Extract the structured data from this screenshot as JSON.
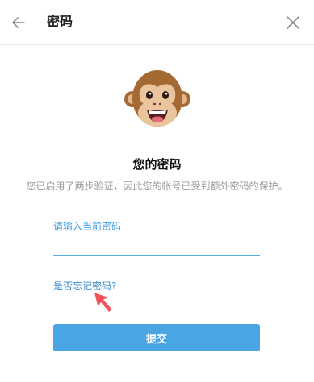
{
  "header": {
    "title": "密码",
    "back_icon": "arrow-left-icon",
    "close_icon": "close-icon"
  },
  "avatar": {
    "icon": "monkey-face-icon"
  },
  "section": {
    "title": "您的密码",
    "description": "您已启用了两步验证，因此您的帐号已受到额外密码的保护。"
  },
  "password_field": {
    "label": "请输入当前密码",
    "value": "",
    "placeholder": ""
  },
  "forgot_link": "是否忘记密码?",
  "submit_label": "提交",
  "colors": {
    "accent": "#4aa6e3",
    "link": "#3b8ed0",
    "cursor": "#f0525a"
  }
}
